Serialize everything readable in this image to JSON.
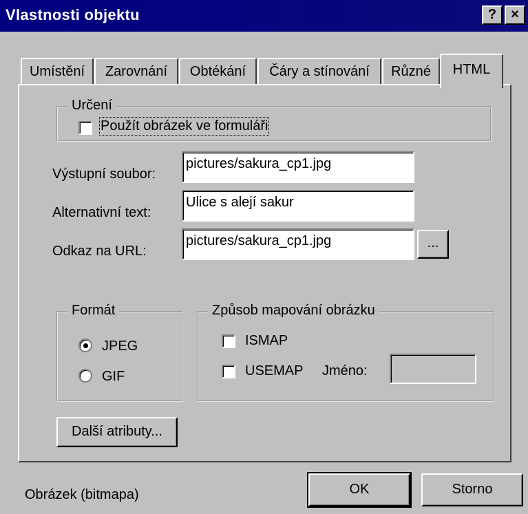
{
  "window": {
    "title": "Vlastnosti objektu",
    "help_label": "?",
    "close_label": "×"
  },
  "tabs": [
    {
      "label": "Umístění"
    },
    {
      "label": "Zarovnání"
    },
    {
      "label": "Obtékání"
    },
    {
      "label": "Čáry a stínování"
    },
    {
      "label": "Různé"
    },
    {
      "label": "HTML",
      "active": true
    }
  ],
  "urceni": {
    "legend": "Určení",
    "checkbox_label": "Použít obrázek ve formuláři",
    "checked": false
  },
  "fields": {
    "output_label": "Výstupní soubor:",
    "output_value": "pictures/sakura_cp1.jpg",
    "alt_label": "Alternativní text:",
    "alt_value": "Ulice s alejí sakur",
    "url_label": "Odkaz na URL:",
    "url_value": "pictures/sakura_cp1.jpg",
    "browse_label": "..."
  },
  "format": {
    "legend": "Formát",
    "jpeg_label": "JPEG",
    "gif_label": "GIF",
    "selected": "JPEG"
  },
  "mapping": {
    "legend": "Způsob mapování obrázku",
    "ismap_label": "ISMAP",
    "usemap_label": "USEMAP",
    "name_label": "Jméno:",
    "name_value": ""
  },
  "more_button": "Další atributy...",
  "status": "Obrázek (bitmapa)",
  "ok_button": "OK",
  "cancel_button": "Storno"
}
